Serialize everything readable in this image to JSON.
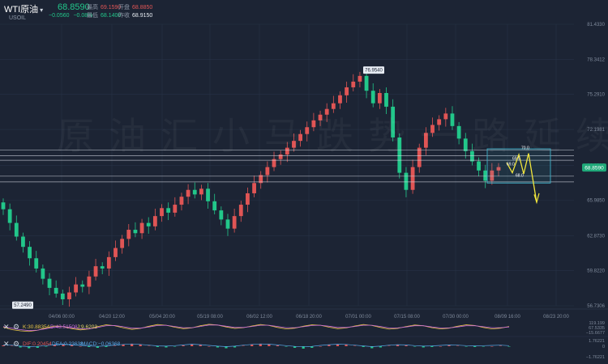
{
  "header": {
    "symbol": "WTI原油",
    "last_price": "68.8590",
    "code": "USOIL",
    "change": "−0.0560",
    "change_pct": "−0.08%",
    "high_label": "最高",
    "high": "69.1590",
    "open_label": "开盘",
    "open": "68.8850",
    "low_label": "最低",
    "low": "68.1400",
    "prev_close_label": "昨收",
    "prev_close": "68.9150"
  },
  "watermark": "原油汇小马跌势一路延续",
  "colors": {
    "background": "#1c2434",
    "up": "#e05555",
    "down": "#22c78a",
    "price_tag": "#1fa979",
    "annotation": "#f1e63c",
    "box": "#3fb0c8"
  },
  "chart_data": {
    "type": "candlestick",
    "x_ticks": [
      "04/06 00:00",
      "04/20 12:00",
      "05/04 20:00",
      "05/19 08:00",
      "06/02 12:00",
      "06/18 20:00",
      "07/01 00:00",
      "07/15 08:00",
      "07/30 00:00",
      "08/09 16:00",
      "08/23 20:00"
    ],
    "y_ticks": [
      "81.4330",
      "78.3412",
      "75.2910",
      "72.1981",
      "69.0589",
      "65.9850",
      "62.8730",
      "59.8220",
      "56.7306"
    ],
    "ylim": [
      56.7306,
      81.433
    ],
    "current_price": "68.8590",
    "high_label": "76.9540",
    "low_label": "57.2490",
    "series": [
      {
        "name": "close",
        "values": [
          65.2,
          64.0,
          62.8,
          61.9,
          60.9,
          60.0,
          59.1,
          58.3,
          57.8,
          57.3,
          57.9,
          58.6,
          58.4,
          59.3,
          60.2,
          60.0,
          61.0,
          61.8,
          62.6,
          63.4,
          63.1,
          64.0,
          63.7,
          64.6,
          65.3,
          64.9,
          65.6,
          66.3,
          66.9,
          66.5,
          67.0,
          65.9,
          65.1,
          64.3,
          63.5,
          64.6,
          65.6,
          66.6,
          67.5,
          68.2,
          68.9,
          69.6,
          70.0,
          70.6,
          71.2,
          71.8,
          72.4,
          73.0,
          73.5,
          74.0,
          74.5,
          75.2,
          75.9,
          76.4,
          76.9,
          75.6,
          74.5,
          75.4,
          74.2,
          71.5,
          68.4,
          66.9,
          68.9,
          70.6,
          71.9,
          72.6,
          73.1,
          73.6,
          72.5,
          71.4,
          70.3,
          69.4,
          68.6,
          67.7,
          68.6,
          68.9
        ]
      },
      {
        "name": "KDJ_K",
        "values": [
          50,
          30,
          20,
          15,
          25,
          45,
          60,
          55,
          38,
          28,
          35,
          55,
          70,
          62,
          45,
          32,
          40,
          58,
          72,
          66,
          50,
          38,
          44,
          62,
          74,
          68,
          52,
          40,
          46,
          60,
          72,
          64,
          48,
          36,
          42,
          58,
          70,
          66,
          50,
          38,
          44,
          60,
          72,
          64,
          48,
          34,
          40,
          56,
          68,
          62,
          46,
          36,
          42,
          58,
          70,
          64,
          48,
          36,
          42,
          56
        ]
      },
      {
        "name": "KDJ_D",
        "values": [
          55,
          42,
          30,
          22,
          26,
          38,
          52,
          56,
          46,
          36,
          36,
          48,
          62,
          64,
          54,
          42,
          42,
          52,
          64,
          66,
          56,
          46,
          46,
          56,
          68,
          68,
          58,
          48,
          48,
          56,
          66,
          66,
          56,
          46,
          46,
          54,
          64,
          66,
          58,
          48,
          48,
          56,
          66,
          66,
          56,
          44,
          44,
          52,
          62,
          62,
          52,
          44,
          44,
          52,
          62,
          62,
          54,
          46,
          46,
          52
        ]
      },
      {
        "name": "MACD",
        "values": [
          0.2,
          0.1,
          -0.3,
          -0.5,
          -0.4,
          -0.1,
          0.3,
          0.5,
          0.3,
          0.0,
          -0.2,
          -0.4,
          -0.2,
          0.1,
          0.4,
          0.6,
          0.4,
          0.1,
          -0.2,
          -0.3,
          -0.1,
          0.2,
          0.5,
          0.3,
          0.0,
          -0.3,
          -0.5,
          -0.3,
          0.1,
          0.4,
          0.6,
          0.5,
          0.2,
          -0.1,
          -0.4,
          -0.6,
          -0.4,
          0.0,
          0.3,
          0.5,
          0.4,
          0.1,
          -0.2,
          -0.5,
          -0.3,
          0.1,
          0.3,
          0.2,
          -0.1,
          -0.3,
          -0.2,
          0.0,
          0.2,
          0.1,
          -0.1,
          -0.2,
          -0.1,
          0.0,
          0.1,
          -0.1
        ]
      }
    ],
    "annotations": [
      {
        "type": "box",
        "label": ""
      },
      {
        "type": "text",
        "label": "70.0"
      },
      {
        "type": "text",
        "label": "69.5"
      },
      {
        "type": "text",
        "label": "69.0"
      },
      {
        "type": "text",
        "label": "68.0"
      }
    ]
  },
  "kdj": {
    "label_k": "K:30.88354",
    "label_d": "D:43.51508",
    "label_j": "J:9.6203",
    "axis_ticks": [
      "119.199",
      "67.5335",
      "−15.6677"
    ]
  },
  "macd": {
    "label_dif": "DIF:0.20454",
    "label_dea": "DEA:0.23638",
    "label_macd": "MACD:−0.06368",
    "axis_ticks": [
      "1.76221",
      "0",
      "−1.76221"
    ]
  },
  "controls": {
    "close1": "✕",
    "settings1": "⚙",
    "close2": "✕",
    "settings2": "⚙"
  }
}
